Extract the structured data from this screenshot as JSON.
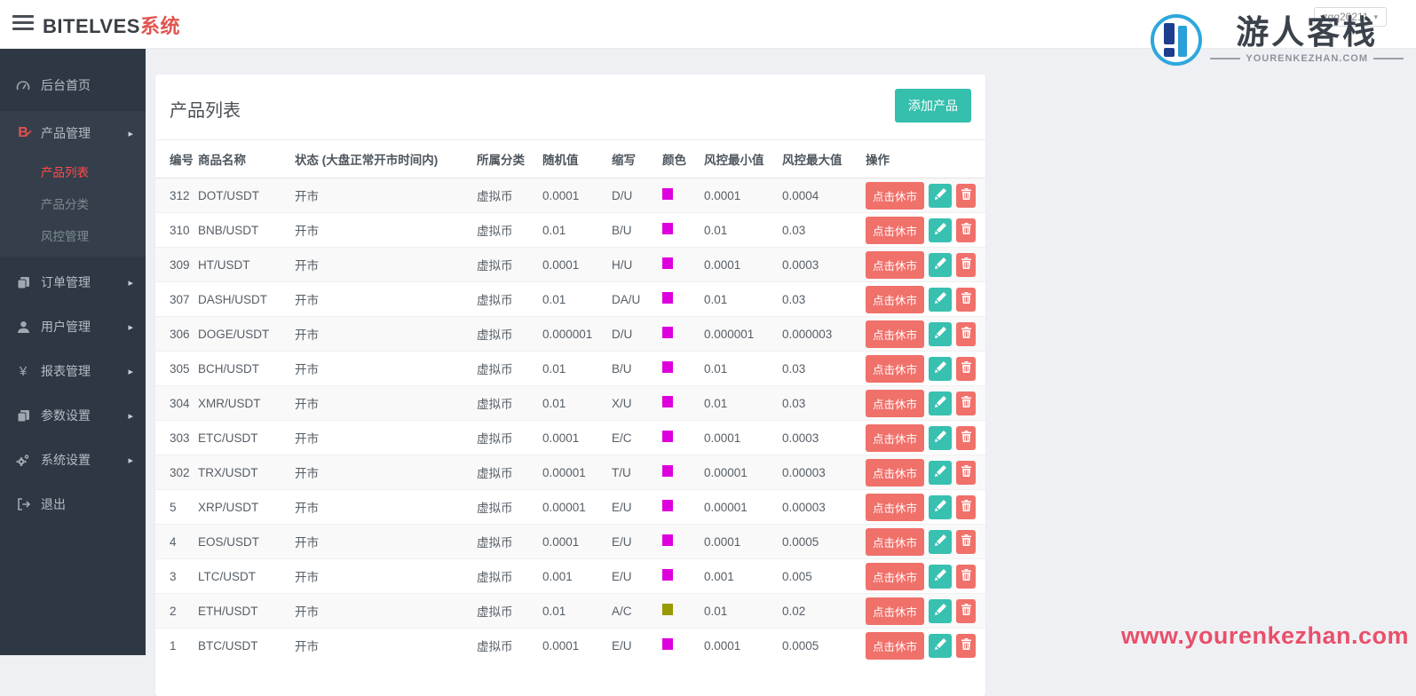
{
  "header": {
    "brand": "BITELVES",
    "brand_suffix": "系统",
    "user": "zgq20211"
  },
  "watermark": {
    "logo_title": "游人客栈",
    "logo_subtitle": "YOURENKEZHAN.COM",
    "footer_url": "www.yourenkezhan.com"
  },
  "sidebar": {
    "items": [
      {
        "label": "后台首页",
        "icon": "dashboard-icon",
        "arrow": false
      },
      {
        "label": "产品管理",
        "icon": "bitcoin-icon",
        "arrow": true,
        "expanded": true,
        "children": [
          {
            "label": "产品列表",
            "active": true
          },
          {
            "label": "产品分类",
            "active": false
          },
          {
            "label": "风控管理",
            "active": false
          }
        ]
      },
      {
        "label": "订单管理",
        "icon": "orders-icon",
        "arrow": true
      },
      {
        "label": "用户管理",
        "icon": "user-icon",
        "arrow": true
      },
      {
        "label": "报表管理",
        "icon": "yen-icon",
        "arrow": true
      },
      {
        "label": "参数设置",
        "icon": "params-icon",
        "arrow": true
      },
      {
        "label": "系统设置",
        "icon": "gear-icon",
        "arrow": true
      },
      {
        "label": "退出",
        "icon": "logout-icon",
        "arrow": false
      }
    ]
  },
  "main": {
    "card_title": "产品列表",
    "add_button": "添加产品",
    "table": {
      "headers": [
        "编号",
        "商品名称",
        "状态 (大盘正常开市时间内)",
        "所属分类",
        "随机值",
        "缩写",
        "颜色",
        "风控最小值",
        "风控最大值",
        "操作"
      ],
      "action_close_label": "点击休市",
      "rows": [
        {
          "id": "312",
          "name": "DOT/USDT",
          "status": "开市",
          "category": "虚拟币",
          "random": "0.0001",
          "abbr": "D/U",
          "color": "#dd00dd",
          "risk_min": "0.0001",
          "risk_max": "0.0004"
        },
        {
          "id": "310",
          "name": "BNB/USDT",
          "status": "开市",
          "category": "虚拟币",
          "random": "0.01",
          "abbr": "B/U",
          "color": "#dd00dd",
          "risk_min": "0.01",
          "risk_max": "0.03"
        },
        {
          "id": "309",
          "name": "HT/USDT",
          "status": "开市",
          "category": "虚拟币",
          "random": "0.0001",
          "abbr": "H/U",
          "color": "#dd00dd",
          "risk_min": "0.0001",
          "risk_max": "0.0003"
        },
        {
          "id": "307",
          "name": "DASH/USDT",
          "status": "开市",
          "category": "虚拟币",
          "random": "0.01",
          "abbr": "DA/U",
          "color": "#dd00dd",
          "risk_min": "0.01",
          "risk_max": "0.03"
        },
        {
          "id": "306",
          "name": "DOGE/USDT",
          "status": "开市",
          "category": "虚拟币",
          "random": "0.000001",
          "abbr": "D/U",
          "color": "#dd00dd",
          "risk_min": "0.000001",
          "risk_max": "0.000003"
        },
        {
          "id": "305",
          "name": "BCH/USDT",
          "status": "开市",
          "category": "虚拟币",
          "random": "0.01",
          "abbr": "B/U",
          "color": "#dd00dd",
          "risk_min": "0.01",
          "risk_max": "0.03"
        },
        {
          "id": "304",
          "name": "XMR/USDT",
          "status": "开市",
          "category": "虚拟币",
          "random": "0.01",
          "abbr": "X/U",
          "color": "#dd00dd",
          "risk_min": "0.01",
          "risk_max": "0.03"
        },
        {
          "id": "303",
          "name": "ETC/USDT",
          "status": "开市",
          "category": "虚拟币",
          "random": "0.0001",
          "abbr": "E/C",
          "color": "#dd00dd",
          "risk_min": "0.0001",
          "risk_max": "0.0003"
        },
        {
          "id": "302",
          "name": "TRX/USDT",
          "status": "开市",
          "category": "虚拟币",
          "random": "0.00001",
          "abbr": "T/U",
          "color": "#dd00dd",
          "risk_min": "0.00001",
          "risk_max": "0.00003"
        },
        {
          "id": "5",
          "name": "XRP/USDT",
          "status": "开市",
          "category": "虚拟币",
          "random": "0.00001",
          "abbr": "E/U",
          "color": "#dd00dd",
          "risk_min": "0.00001",
          "risk_max": "0.00003"
        },
        {
          "id": "4",
          "name": "EOS/USDT",
          "status": "开市",
          "category": "虚拟币",
          "random": "0.0001",
          "abbr": "E/U",
          "color": "#dd00dd",
          "risk_min": "0.0001",
          "risk_max": "0.0005"
        },
        {
          "id": "3",
          "name": "LTC/USDT",
          "status": "开市",
          "category": "虚拟币",
          "random": "0.001",
          "abbr": "E/U",
          "color": "#dd00dd",
          "risk_min": "0.001",
          "risk_max": "0.005"
        },
        {
          "id": "2",
          "name": "ETH/USDT",
          "status": "开市",
          "category": "虚拟币",
          "random": "0.01",
          "abbr": "A/C",
          "color": "#999900",
          "risk_min": "0.01",
          "risk_max": "0.02"
        },
        {
          "id": "1",
          "name": "BTC/USDT",
          "status": "开市",
          "category": "虚拟币",
          "random": "0.0001",
          "abbr": "E/U",
          "color": "#dd00dd",
          "risk_min": "0.0001",
          "risk_max": "0.0005"
        }
      ]
    }
  },
  "colors": {
    "accent_teal": "#35bfad",
    "accent_salmon": "#f0706a",
    "active_red": "#ff4a4a",
    "sidebar_bg": "#2d3844",
    "content_bg": "#eef0f4"
  }
}
